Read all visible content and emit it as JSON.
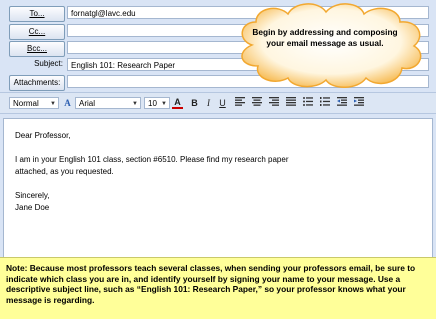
{
  "header": {
    "to_label": "To...",
    "to_value": "fornatgl@lavc.edu",
    "cc_label": "Cc...",
    "cc_value": "",
    "bcc_label": "Bcc...",
    "bcc_value": "",
    "subject_label": "Subject:",
    "subject_value": "English 101: Research Paper",
    "attachments_label": "Attachments:"
  },
  "toolbar": {
    "style": "Normal",
    "font": "Arial",
    "size": "10",
    "bold": "B",
    "italic": "I",
    "underline": "U"
  },
  "message": {
    "line1": "Dear Professor,",
    "line2": "I am in your English 101 class, section #6510. Please find my research paper",
    "line3": "attached, as you requested.",
    "line4": "Sincerely,",
    "line5": "Jane Doe"
  },
  "callout": {
    "text": "Begin by addressing and composing your email message as usual."
  },
  "note": {
    "text": "Note: Because most professors teach several classes, when sending your professors email, be sure to indicate which class you are in, and identify yourself by signing your name to your message. Use a descriptive subject line, such as “English 101: Research Paper,” so your professor knows what your message is regarding."
  },
  "colors": {
    "frame": "#d9e4f5",
    "note_bg": "#ffff99",
    "font_color_accent": "#cc0000"
  }
}
